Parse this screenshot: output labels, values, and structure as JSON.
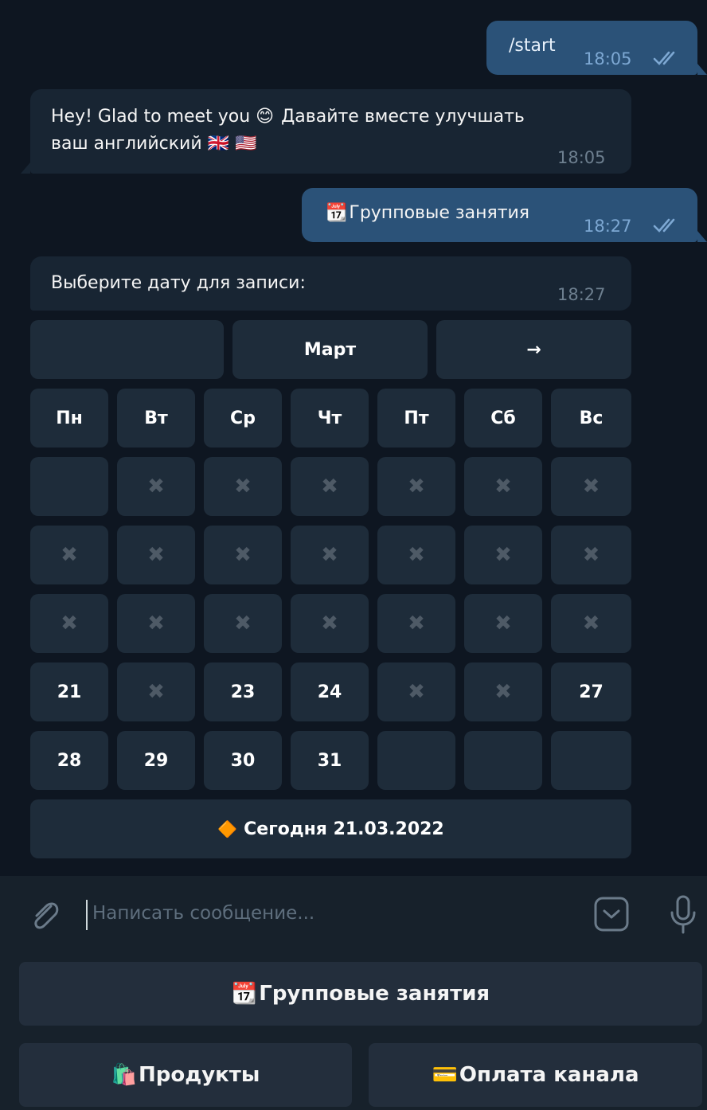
{
  "messages": {
    "m1": {
      "text": "/start",
      "time": "18:05"
    },
    "m2": {
      "line1": "Hey! Glad to meet you",
      "line1b": "Давайте вместе улучшать",
      "line2": "ваш английский",
      "emoji_smile": "😊",
      "flags": "🇬🇧 🇺🇸",
      "time": "18:05"
    },
    "m3": {
      "text": "Групповые занятия",
      "emoji": "📆",
      "time": "18:27"
    },
    "m4": {
      "text": "Выберите дату для записи:",
      "time": "18:27"
    }
  },
  "calendar": {
    "nav": {
      "prev": "",
      "month": "Март",
      "next": "→"
    },
    "weekdays": [
      "Пн",
      "Вт",
      "Ср",
      "Чт",
      "Пт",
      "Сб",
      "Вс"
    ],
    "unavailable_mark": "✖",
    "rows": [
      [
        "",
        "✖",
        "✖",
        "✖",
        "✖",
        "✖",
        "✖"
      ],
      [
        "✖",
        "✖",
        "✖",
        "✖",
        "✖",
        "✖",
        "✖"
      ],
      [
        "✖",
        "✖",
        "✖",
        "✖",
        "✖",
        "✖",
        "✖"
      ],
      [
        "21",
        "✖",
        "23",
        "24",
        "✖",
        "✖",
        "27"
      ],
      [
        "28",
        "29",
        "30",
        "31",
        "",
        "",
        ""
      ]
    ],
    "today": {
      "icon": "🔶",
      "label": "Сегодня 21.03.2022"
    }
  },
  "composer": {
    "placeholder": "Написать сообщение...",
    "icons": [
      "paperclip-icon",
      "bot-keyboard-icon",
      "microphone-icon"
    ]
  },
  "reply_keyboard": {
    "group": {
      "emoji": "📆",
      "label": "Групповые занятия"
    },
    "products": {
      "emoji": "🛍️",
      "label": "Продукты"
    },
    "payment": {
      "emoji": "💳",
      "label": "Оплата канала"
    }
  },
  "colors": {
    "background": "#0e1621",
    "outgoing": "#2b5278",
    "incoming": "#182533",
    "button": "#1e2c3a",
    "composer": "#17212b"
  }
}
